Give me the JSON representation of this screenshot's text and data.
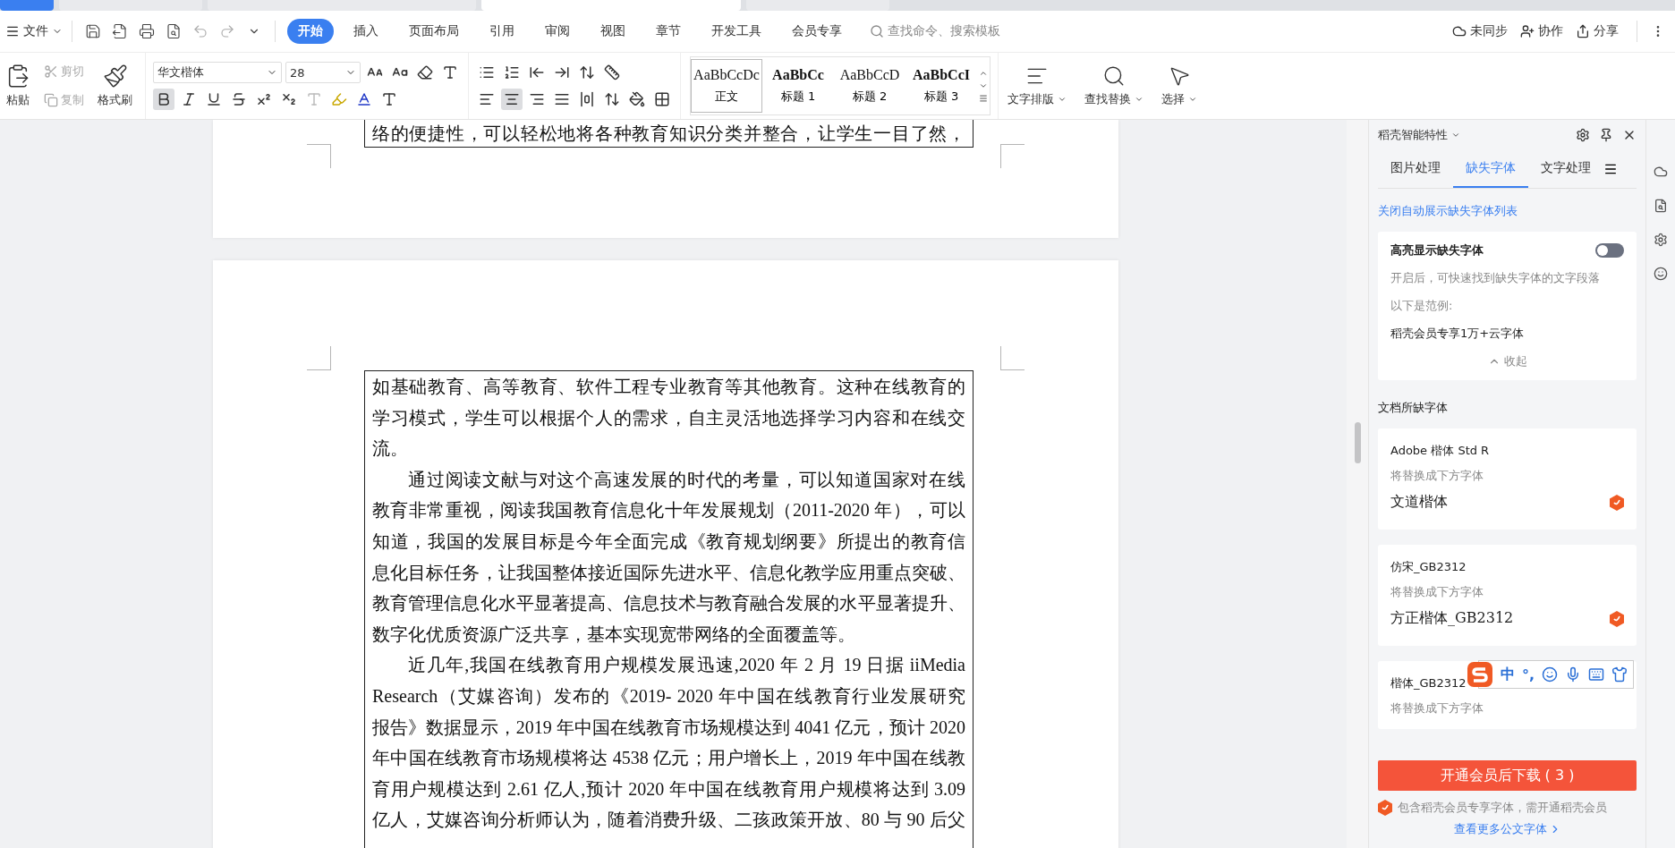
{
  "menu_bar": {
    "file_menu": "文件",
    "tabs": [
      {
        "label": "开始",
        "selected": true
      },
      {
        "label": "插入",
        "selected": false
      },
      {
        "label": "页面布局",
        "selected": false
      },
      {
        "label": "引用",
        "selected": false
      },
      {
        "label": "审阅",
        "selected": false
      },
      {
        "label": "视图",
        "selected": false
      },
      {
        "label": "章节",
        "selected": false
      },
      {
        "label": "开发工具",
        "selected": false
      },
      {
        "label": "会员专享",
        "selected": false
      }
    ],
    "search": {
      "placeholder": "查找命令、搜索模板"
    },
    "actions": [
      {
        "kind": "sync",
        "label": "未同步"
      },
      {
        "kind": "collab",
        "label": "协作"
      },
      {
        "kind": "share",
        "label": "分享"
      }
    ]
  },
  "ribbon": {
    "paste": "粘贴",
    "cut": "剪切",
    "copy": "复制",
    "format_painter": "格式刷",
    "font_name": "华文楷体",
    "font_size": "28",
    "format_buttons": [
      {
        "kind": "bold",
        "active": true
      },
      {
        "kind": "italic",
        "active": false
      },
      {
        "kind": "underline",
        "active": false
      }
    ],
    "align_buttons": [
      {
        "kind": "left",
        "selected": false
      },
      {
        "kind": "center",
        "selected": true
      },
      {
        "kind": "right",
        "selected": false
      },
      {
        "kind": "justify",
        "selected": false
      }
    ],
    "styles": [
      {
        "preview": "AaBbCcDc",
        "label": "正文",
        "bold": false,
        "selected": true
      },
      {
        "preview": "AaBbCc",
        "label": "标题 1",
        "bold": true,
        "selected": false
      },
      {
        "preview": "AaBbCcD",
        "label": "标题 2",
        "bold": false,
        "selected": false
      },
      {
        "preview": "AaBbCcI",
        "label": "标题 3",
        "bold": true,
        "selected": false
      }
    ],
    "tools": [
      {
        "kind": "layout",
        "label": "文字排版"
      },
      {
        "kind": "find",
        "label": "查找替换"
      },
      {
        "kind": "select",
        "label": "选择"
      }
    ]
  },
  "document": {
    "previous_page_line": "络的便捷性，可以轻松地将各种教育知识分类并整合，让学生一目了然，",
    "paragraphs": [
      {
        "indent": false,
        "lines": [
          "如基础教育、高等教育、软件工程专业教育等其他教育。这种在线教育的",
          "学习模式，学生可以根据个人的需求，自主灵活地选择学习内容和在线交",
          "流。"
        ]
      },
      {
        "indent": true,
        "lines": [
          "通过阅读文献与对这个高速发展的时代的考量，可以知道国家对在线",
          "教育非常重视，阅读我国教育信息化十年发展规划（2011-2020 年），可以",
          "知道，我国的发展目标是今年全面完成《教育规划纲要》所提出的教育信",
          "息化目标任务，让我国整体接近国际先进水平、信息化教学应用重点突破、",
          "教育管理信息化水平显著提高、信息技术与教育融合发展的水平显著提升、",
          "数字化优质资源广泛共享，基本实现宽带网络的全面覆盖等。"
        ]
      },
      {
        "indent": true,
        "lines": [
          "近几年,我国在线教育用户规模发展迅速,2020 年 2 月 19 日据 iiMedia",
          "Research（艾媒咨询）发布的《2019- 2020 年中国在线教育行业发展研究",
          "报告》数据显示，2019 年中国在线教育市场规模达到 4041 亿元，预计 2020",
          "年中国在线教育市场规模将达 4538 亿元；用户增长上，2019 年中国在线教",
          "育用户规模达到 2.61 亿人,预计 2020 年中国在线教育用户规模将达到 3.09",
          "亿人，艾媒咨询分析师认为，随着消费升级、二孩政策开放、80 与 90 后父"
        ]
      }
    ]
  },
  "side_panel": {
    "title": "稻壳智能特性",
    "tabs": [
      {
        "label": "图片处理",
        "selected": false
      },
      {
        "label": "缺失字体",
        "selected": true
      },
      {
        "label": "文字处理",
        "selected": false
      }
    ],
    "link": "关闭自动展示缺失字体列表",
    "highlight_card": {
      "title": "高亮显示缺失字体",
      "on": false,
      "description": "开启后，可快速找到缺失字体的文字段落",
      "example_label": "以下是范例:",
      "example": "稻壳会员专享1万+云字体",
      "collapse": "收起"
    },
    "section_title": "文档所缺字体",
    "missing_fonts": [
      {
        "name": "Adobe 楷体 Std R",
        "hint": "将替换成下方字体",
        "replacement": "文道楷体",
        "premium": true
      },
      {
        "name": "仿宋_GB2312",
        "hint": "将替换成下方字体",
        "replacement": "方正楷体_GB2312",
        "premium": true
      },
      {
        "name": "楷体_GB2312",
        "hint": "将替换成下方字体"
      }
    ],
    "download_button": "开通会员后下载 ( 3 )",
    "notice": "包含稻壳会员专享字体，需开通稻壳会员",
    "more_link": "查看更多公文字体"
  },
  "ime_bar": {
    "mode": "中",
    "punctuation": "°,"
  }
}
